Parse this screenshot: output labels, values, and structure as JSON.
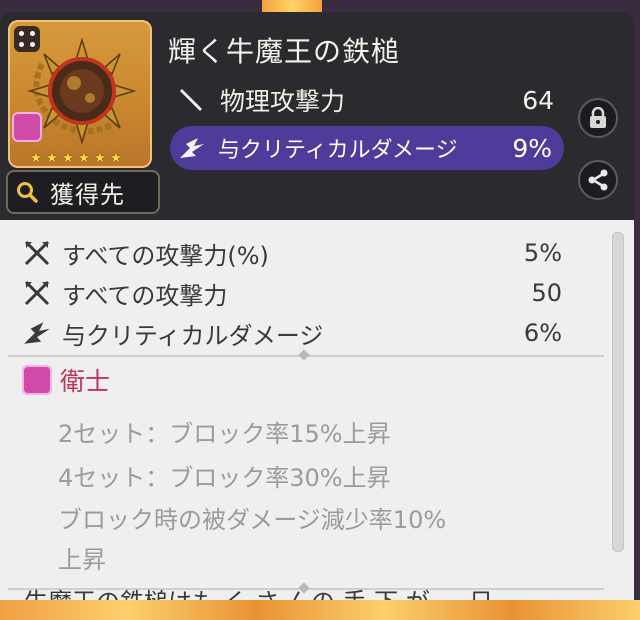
{
  "item": {
    "name": "輝く牛魔王の鉄槌",
    "rarity_stars": 6,
    "source_button": "獲得先",
    "main_stat": {
      "name": "物理攻撃力",
      "value": "64"
    },
    "sub_stat": {
      "name": "与クリティカルダメージ",
      "value": "9%"
    }
  },
  "substats": [
    {
      "name": "すべての攻撃力(%)",
      "value": "5%",
      "icon": "crossed-swords-icon"
    },
    {
      "name": "すべての攻撃力",
      "value": "50",
      "icon": "crossed-swords-icon"
    },
    {
      "name": "与クリティカルダメージ",
      "value": "6%",
      "icon": "critical-burst-icon"
    }
  ],
  "set": {
    "name": "衛士",
    "effects": [
      "2セット：ブロック率15%上昇",
      "4セット：ブロック率30%上昇",
      "ブロック時の被ダメージ減少率10%",
      "上昇"
    ]
  },
  "description_partial": "牛魔王の鉄槌はも く さ んの 手 下 が ― 日",
  "colors": {
    "header_bg": "#2b2b2f",
    "body_bg": "#efefef",
    "sub_stat_highlight": "#4f3b9a",
    "set_name": "#c0345a",
    "star": "#ffd84a"
  }
}
